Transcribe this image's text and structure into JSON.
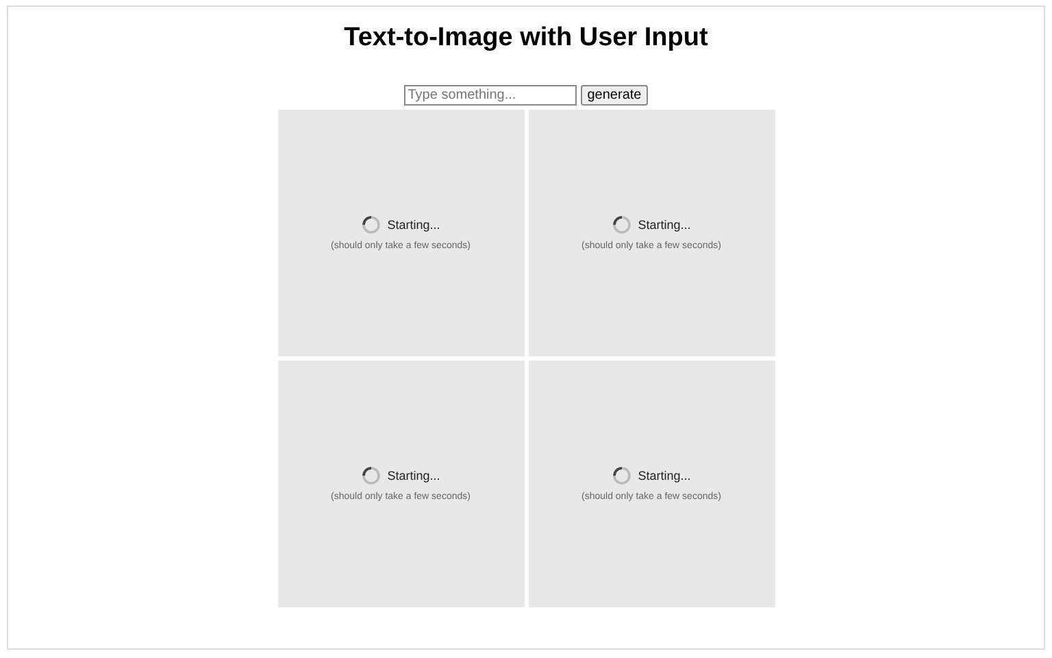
{
  "title": "Text-to-Image with User Input",
  "prompt": {
    "placeholder": "Type something..."
  },
  "button": "generate",
  "tiles": [
    {
      "status": "Starting...",
      "note": "(should only take a few seconds)"
    },
    {
      "status": "Starting...",
      "note": "(should only take a few seconds)"
    },
    {
      "status": "Starting...",
      "note": "(should only take a few seconds)"
    },
    {
      "status": "Starting...",
      "note": "(should only take a few seconds)"
    }
  ]
}
